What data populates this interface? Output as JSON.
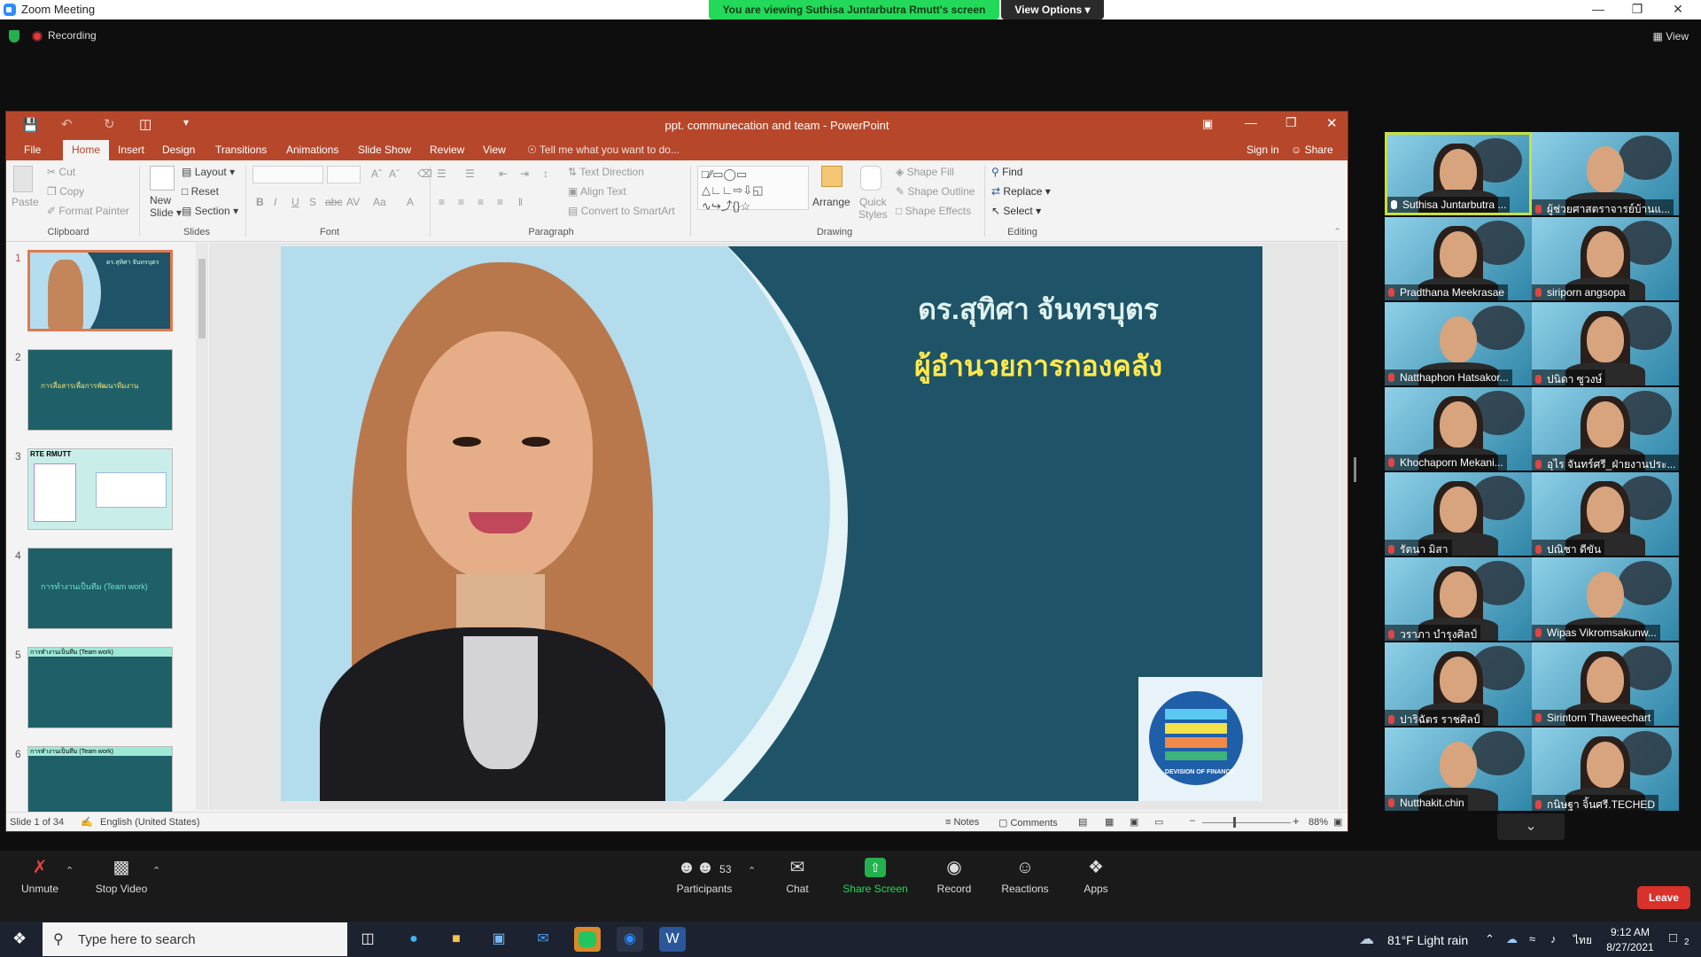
{
  "zoom": {
    "window_title": "Zoom Meeting",
    "banner": "You are viewing Suthisa  Juntarbutra Rmutt's screen",
    "view_options": "View Options",
    "recording": "Recording",
    "view_button": "View"
  },
  "ppt": {
    "title": "ppt. communecation and team  -  PowerPoint",
    "tabs": [
      "File",
      "Home",
      "Insert",
      "Design",
      "Transitions",
      "Animations",
      "Slide Show",
      "Review",
      "View"
    ],
    "tell_me": "Tell me what you want to do...",
    "sign_in": "Sign in",
    "share": "Share",
    "ribbon": {
      "paste": "Paste",
      "cut": "Cut",
      "copy": "Copy",
      "format_painter": "Format Painter",
      "new_slide_1": "New",
      "new_slide_2": "Slide",
      "layout": "Layout",
      "reset": "Reset",
      "section": "Section",
      "text_direction": "Text Direction",
      "align_text": "Align Text",
      "convert_smartart": "Convert to SmartArt",
      "arrange": "Arrange",
      "quick_styles_1": "Quick",
      "quick_styles_2": "Styles",
      "shape_fill": "Shape Fill",
      "shape_outline": "Shape Outline",
      "shape_effects": "Shape Effects",
      "find": "Find",
      "replace": "Replace",
      "select": "Select",
      "groups": [
        "Clipboard",
        "Slides",
        "Font",
        "Paragraph",
        "Drawing",
        "Editing"
      ]
    },
    "slide_numbers": [
      "1",
      "2",
      "3",
      "4",
      "5",
      "6"
    ],
    "thumb_texts": [
      "ดร.สุทิศา จันทรบุตร",
      "การสื่อสารเพื่อการพัฒนาทีมงาน",
      "RTE RMUTT",
      "การทำงานเป็นทีม (Team work)",
      "การทำงานเป็นทีม (Team work)",
      "การทำงานเป็นทีม (Team work)"
    ],
    "slide": {
      "name": "ดร.สุทิศา จันทรบุตร",
      "position": "ผู้อำนวยการกองคลัง",
      "logo_text": "DEVISION OF FINANCE"
    },
    "status": {
      "slide_of": "Slide 1 of 34",
      "language": "English (United States)",
      "notes": "Notes",
      "comments": "Comments",
      "zoom": "88%"
    }
  },
  "gallery": [
    {
      "name": "Suthisa  Juntarbutra ..."
    },
    {
      "name": "ผู้ช่วยศาสตราจารย์บ้านแ..."
    },
    {
      "name": "Pradthana Meekrasae"
    },
    {
      "name": "siriporn angsopa"
    },
    {
      "name": "Natthaphon Hatsakor..."
    },
    {
      "name": "ปนิดา ซูวงษ์"
    },
    {
      "name": "Khochaporn Mekani..."
    },
    {
      "name": "อุไร จันทร์ศรี_ฝ่ายงานประ..."
    },
    {
      "name": "รัตนา มิสา"
    },
    {
      "name": "ปณิชา ดีขัน"
    },
    {
      "name": "วราภา บำรุงศิลป์"
    },
    {
      "name": "Wipas Vikromsakunw..."
    },
    {
      "name": "ปาริฉัตร ราชศิลป์"
    },
    {
      "name": "Sirintorn Thaweechart"
    },
    {
      "name": "Nutthakit.chin"
    },
    {
      "name": "กนิษฐา จิ้นศรี.TECHED"
    }
  ],
  "toolbar": {
    "unmute": "Unmute",
    "stop_video": "Stop Video",
    "participants": "Participants",
    "participants_count": "53",
    "chat": "Chat",
    "share_screen": "Share Screen",
    "record": "Record",
    "reactions": "Reactions",
    "apps": "Apps",
    "leave": "Leave"
  },
  "taskbar": {
    "search_placeholder": "Type here to search",
    "weather": "81°F  Light rain",
    "lang": "ไทย",
    "time": "9:12 AM",
    "date": "8/27/2021",
    "notifications": "2"
  },
  "colors": {
    "ppt_brand": "#b7472a",
    "slide_teal": "#1f5367",
    "zoom_green": "#23d959",
    "leave_red": "#d9312b"
  }
}
